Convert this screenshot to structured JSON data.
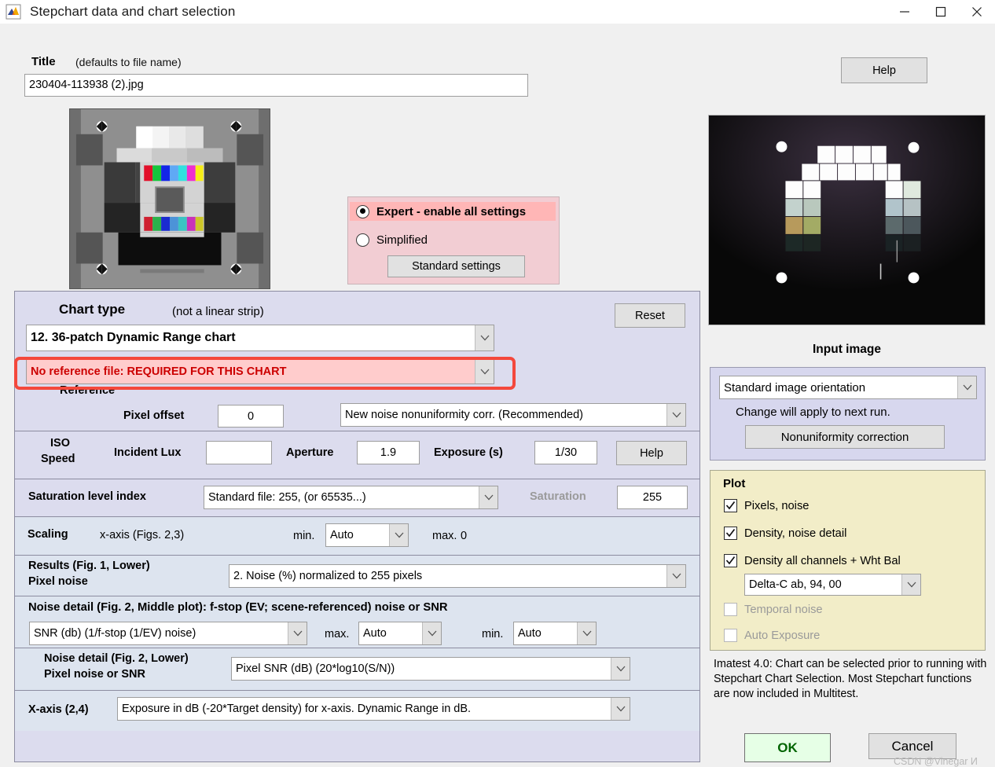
{
  "window": {
    "title": "Stepchart data and chart selection",
    "icon": "matlab-icon",
    "minimize": "—",
    "maximize": "□",
    "close": "✕"
  },
  "title_field": {
    "label": "Title",
    "note": "(defaults to file name)",
    "value": "230404-113938 (2).jpg"
  },
  "help_top": {
    "label": "Help"
  },
  "mode": {
    "expert_label": "Expert - enable all settings",
    "simplified_label": "Simplified",
    "selected": "expert",
    "standard_settings_label": "Standard settings",
    "highlight_color": "#ffb6b6",
    "box_color": "#f2cdd3"
  },
  "chart": {
    "heading": "Chart type",
    "heading_note": "(not a linear strip)",
    "reset_label": "Reset",
    "type_value": "12. 36-patch Dynamic Range chart",
    "reference_error": "No reference file: REQUIRED FOR THIS CHART",
    "reference_label": "Reference",
    "error_color": "#cc0000",
    "error_bg": "#ffcccc",
    "highlight_border": "#f4483c",
    "pixel_offset_label": "Pixel offset",
    "pixel_offset_value": "0",
    "nonuniformity_value": "New noise nonuniformity corr. (Recommended)"
  },
  "iso": {
    "label_line1": "ISO",
    "label_line2": "Speed",
    "incident_lux_label": "Incident Lux",
    "incident_lux_value": "",
    "aperture_label": "Aperture",
    "aperture_value": "1.9",
    "exposure_label": "Exposure (s)",
    "exposure_value": "1/30",
    "help_label": "Help"
  },
  "saturation": {
    "index_label": "Saturation level index",
    "index_value": "Standard file:  255, (or 65535...)",
    "sat_label": "Saturation",
    "sat_value": "255"
  },
  "scaling": {
    "label": "Scaling",
    "axis_label": "x-axis (Figs. 2,3)",
    "min_label": "min.",
    "min_value": "Auto",
    "max_label": "max.",
    "max_value": "0"
  },
  "results": {
    "label_line1": "Results (Fig. 1, Lower)",
    "label_line2": "Pixel noise",
    "value": "2. Noise (%) normalized to 255 pixels"
  },
  "noise_middle": {
    "heading": "Noise detail (Fig. 2, Middle plot):   f-stop (EV; scene-referenced) noise or SNR",
    "value": "SNR (db) (1/f-stop (1/EV) noise)",
    "max_label": "max.",
    "max_value": "Auto",
    "min_label": "min.",
    "min_value": "Auto"
  },
  "noise_lower": {
    "label_line1": "Noise detail (Fig. 2, Lower)",
    "label_line2": "Pixel noise or SNR",
    "value": "Pixel SNR (dB)  (20*log10(S/N))"
  },
  "xaxis": {
    "label": "X-axis (2,4)",
    "value": "Exposure in dB (-20*Target density) for x-axis.   Dynamic Range in dB."
  },
  "input_image": {
    "title": "Input image",
    "orientation_value": "Standard image orientation",
    "change_note": "Change will apply to next run.",
    "nonuniformity_button": "Nonuniformity correction"
  },
  "plot": {
    "heading": "Plot",
    "items": [
      {
        "label": "Pixels, noise",
        "checked": true,
        "disabled": false
      },
      {
        "label": "Density, noise detail",
        "checked": true,
        "disabled": false
      },
      {
        "label": "Density all channels + Wht Bal",
        "checked": true,
        "disabled": false
      },
      {
        "label": "Temporal noise",
        "checked": false,
        "disabled": true
      },
      {
        "label": "Auto Exposure",
        "checked": false,
        "disabled": true
      }
    ],
    "delta_value": "Delta-C ab, 94, 00"
  },
  "note": "Imatest 4.0: Chart can be selected prior to running with Stepchart Chart Selection. Most Stepchart functions are now included in Multitest.",
  "footer": {
    "ok_label": "OK",
    "cancel_label": "Cancel",
    "ok_color": "#006400",
    "watermark": "CSDN @Vinegar И"
  }
}
